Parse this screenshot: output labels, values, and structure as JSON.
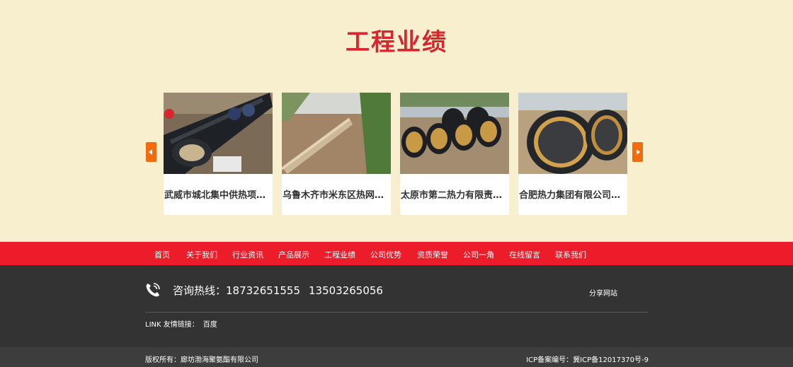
{
  "section": {
    "title": "工程业绩"
  },
  "carousel": {
    "prev_icon": "arrow-left-icon",
    "next_icon": "arrow-right-icon",
    "accent": "#f16b0f",
    "items": [
      {
        "caption": "武威市城北集中供热项目…"
      },
      {
        "caption": "乌鲁木齐市米东区热网工…"
      },
      {
        "caption": "太原市第二热力有限责任…"
      },
      {
        "caption": "合肥热力集团有限公司直…"
      }
    ]
  },
  "nav": {
    "color": "#ec1c2a",
    "items": [
      {
        "label": "首页"
      },
      {
        "label": "关于我们"
      },
      {
        "label": "行业资讯"
      },
      {
        "label": "产品展示"
      },
      {
        "label": "工程业绩"
      },
      {
        "label": "公司优势"
      },
      {
        "label": "资质荣誉"
      },
      {
        "label": "公司一角"
      },
      {
        "label": "在线留言"
      },
      {
        "label": "联系我们"
      }
    ]
  },
  "footer": {
    "phone_icon": "phone-icon",
    "hotline_label": "咨询热线：",
    "phone1": "18732651555",
    "phone2": "13503265056",
    "share": "分享网站",
    "links_label": "LINK 友情链接：",
    "links": [
      {
        "label": "百度"
      }
    ],
    "copyright": "版权所有：廊坊渤海聚氨酯有限公司",
    "icp": "ICP备案编号：冀ICP备12017370号-9"
  }
}
